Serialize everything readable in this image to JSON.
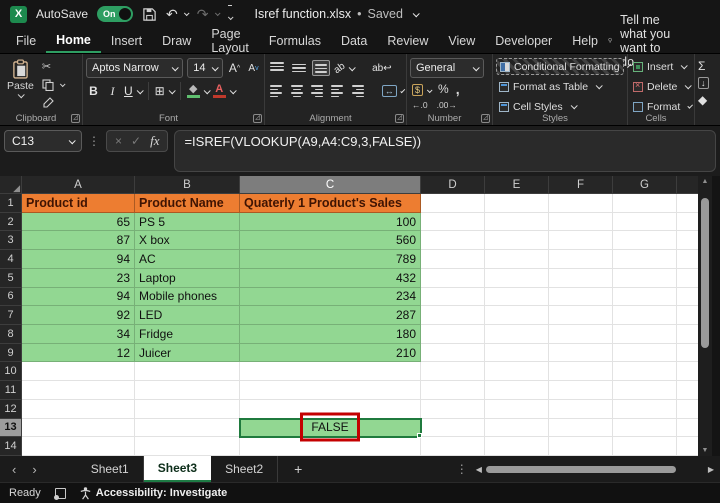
{
  "titlebar": {
    "app_initial": "X",
    "autosave_label": "AutoSave",
    "autosave_state": "On",
    "doc_title": "Isref function.xlsx",
    "separator": "•",
    "doc_status": "Saved"
  },
  "menu": {
    "tabs": [
      "File",
      "Home",
      "Insert",
      "Draw",
      "Page Layout",
      "Formulas",
      "Data",
      "Review",
      "View",
      "Developer",
      "Help"
    ],
    "active_tab": "Home",
    "search_placeholder": "Tell me what you want to do"
  },
  "ribbon": {
    "clipboard": {
      "label": "Clipboard",
      "paste_label": "Paste"
    },
    "font": {
      "label": "Font",
      "font_name": "Aptos Narrow",
      "font_size": "14",
      "bold": "B",
      "italic": "I",
      "underline": "U",
      "grow_font": "A",
      "shrink_font": "A"
    },
    "alignment": {
      "label": "Alignment"
    },
    "number": {
      "label": "Number",
      "format": "General",
      "percent": "%",
      "comma": ",",
      "accounting": "$",
      "increase_decimal": "←.0",
      "decrease_decimal": ".00→"
    },
    "styles": {
      "label": "Styles",
      "items": [
        "Conditional Formatting",
        "Format as Table",
        "Cell Styles"
      ]
    },
    "cells": {
      "label": "Cells",
      "items": [
        "Insert",
        "Delete",
        "Format"
      ]
    },
    "editing": {
      "autosum": "Σ",
      "fill": "↓",
      "clear": "◆"
    }
  },
  "formula_bar": {
    "cell_ref": "C13",
    "cancel": "×",
    "enter": "✓",
    "fx_label": "fx",
    "formula": "=ISREF(VLOOKUP(A9,A4:C9,3,FALSE))"
  },
  "grid": {
    "col_headers": [
      "A",
      "B",
      "C",
      "D",
      "E",
      "F",
      "G"
    ],
    "selected_col": "C",
    "selected_row": "13",
    "rows": [
      {
        "n": "1",
        "style": "header",
        "cells": {
          "A": "Product id",
          "B": "Product Name",
          "C": "Quaterly 1 Product's Sales"
        }
      },
      {
        "n": "2",
        "style": "data",
        "cells": {
          "A": "65",
          "B": "PS 5",
          "C": "100"
        }
      },
      {
        "n": "3",
        "style": "data",
        "cells": {
          "A": "87",
          "B": "X box",
          "C": "560"
        }
      },
      {
        "n": "4",
        "style": "data",
        "cells": {
          "A": "94",
          "B": "AC",
          "C": "789"
        }
      },
      {
        "n": "5",
        "style": "data",
        "cells": {
          "A": "23",
          "B": "Laptop",
          "C": "432"
        }
      },
      {
        "n": "6",
        "style": "data",
        "cells": {
          "A": "94",
          "B": "Mobile phones",
          "C": "234"
        }
      },
      {
        "n": "7",
        "style": "data",
        "cells": {
          "A": "92",
          "B": "LED",
          "C": "287"
        }
      },
      {
        "n": "8",
        "style": "data",
        "cells": {
          "A": "34",
          "B": "Fridge",
          "C": "180"
        }
      },
      {
        "n": "9",
        "style": "data",
        "cells": {
          "A": "12",
          "B": "Juicer",
          "C": "210"
        }
      },
      {
        "n": "10",
        "style": "empty",
        "cells": {}
      },
      {
        "n": "11",
        "style": "empty",
        "cells": {}
      },
      {
        "n": "12",
        "style": "empty",
        "cells": {}
      },
      {
        "n": "13",
        "style": "result",
        "cells": {
          "C": "FALSE"
        }
      },
      {
        "n": "14",
        "style": "empty",
        "cells": {}
      }
    ]
  },
  "sheet_bar": {
    "tabs": [
      "Sheet1",
      "Sheet3",
      "Sheet2"
    ],
    "active_tab": "Sheet3",
    "add_label": "+"
  },
  "status_bar": {
    "mode": "Ready",
    "accessibility": "Accessibility: Investigate"
  },
  "icons": {
    "cut": "✂",
    "undo": "↶",
    "redo": "↷",
    "borders": "⊞",
    "merge": "↔",
    "wrap_text": "ab↩",
    "orientation": "ab",
    "select_all": "◢",
    "prev_sheet": "‹",
    "next_sheet": "›",
    "more": "⋮",
    "dots": "⋮",
    "up": "▲",
    "down": "▼",
    "left": "◀",
    "right": "▶",
    "launcher": "◿"
  },
  "colors": {
    "accent_green": "#1e7c45",
    "toggle_green": "#2e9e62",
    "header_fill": "#ED7D31",
    "data_fill": "#92D792",
    "annotation_red": "#C40000"
  }
}
